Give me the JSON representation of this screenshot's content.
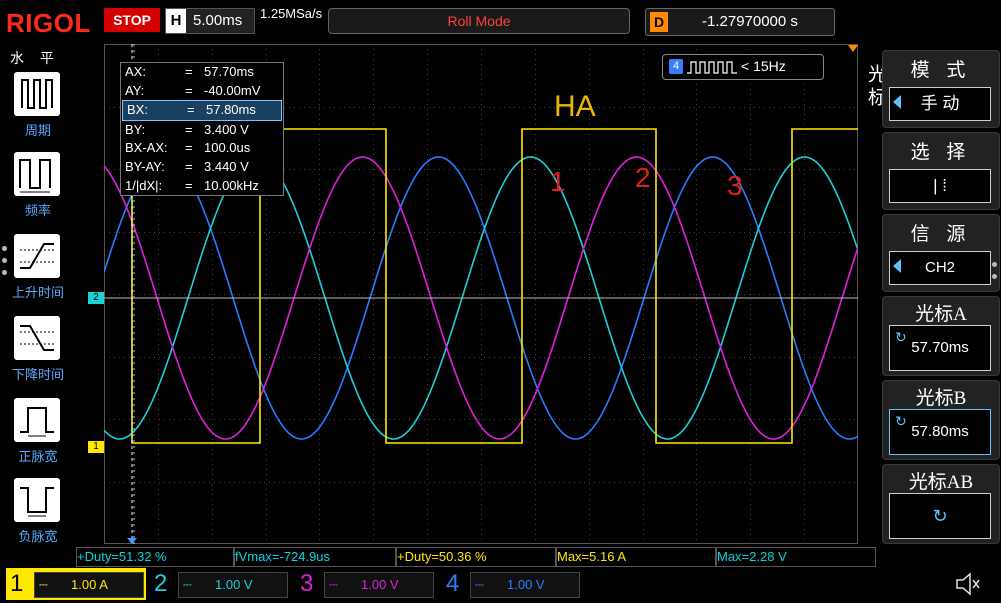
{
  "topbar": {
    "brand": "RIGOL",
    "run_state": "STOP",
    "timebase_tag": "H",
    "timebase": "5.00ms",
    "sample_rate": "1.25MSa/s",
    "mode": "Roll Mode",
    "delay_tag": "D",
    "delay": "-1.27970000 s"
  },
  "left_menu": {
    "header": "水 平",
    "items": [
      {
        "label": "周期",
        "icon": "period-icon"
      },
      {
        "label": "频率",
        "icon": "frequency-icon"
      },
      {
        "label": "上升时间",
        "icon": "rise-time-icon"
      },
      {
        "label": "下降时间",
        "icon": "fall-time-icon"
      },
      {
        "label": "正脉宽",
        "icon": "positive-width-icon"
      },
      {
        "label": "负脉宽",
        "icon": "negative-width-icon"
      }
    ]
  },
  "cursor_table": [
    {
      "key": "AX:",
      "value": "57.70ms"
    },
    {
      "key": "AY:",
      "value": "-40.00mV"
    },
    {
      "key": "BX:",
      "value": "57.80ms"
    },
    {
      "key": "BY:",
      "value": "3.400 V"
    },
    {
      "key": "BX-AX:",
      "value": "100.0us"
    },
    {
      "key": "BY-AY:",
      "value": "3.440 V"
    },
    {
      "key": "1/|dX|:",
      "value": "10.00kHz"
    }
  ],
  "trigger": {
    "channel": "4",
    "frequency": "< 15Hz"
  },
  "annotations": {
    "title": "HA",
    "n1": "1",
    "n2": "2",
    "n3": "3"
  },
  "markers": {
    "ch1": "1",
    "ch2": "2"
  },
  "measurements": [
    {
      "text": "+Duty=51.32 %",
      "color": "#00d8e0"
    },
    {
      "text": "fVmax=-724.9us",
      "color": "#00d8e0"
    },
    {
      "text": "+Duty=50.36 %",
      "color": "#ffe800"
    },
    {
      "text": "Max=5.16 A",
      "color": "#ffe800"
    },
    {
      "text": "Max=2.28 V",
      "color": "#00d8e0"
    }
  ],
  "channels": [
    {
      "num": "1",
      "scale": "1.00 A",
      "color": "#ffe800"
    },
    {
      "num": "2",
      "scale": "1.00 V",
      "color": "#1ed0d8"
    },
    {
      "num": "3",
      "scale": "1.00 V",
      "color": "#e020e0"
    },
    {
      "num": "4",
      "scale": "1.00 V",
      "color": "#2a7cff"
    }
  ],
  "right_menu": {
    "cursor_caption": "光标",
    "mode_title": "模 式",
    "mode_value": "手 动",
    "select_title": "选 择",
    "select_value": "| ⁞",
    "source_title": "信 源",
    "source_value": "CH2",
    "cursor_a_title": "光标A",
    "cursor_a_value": "57.70ms",
    "cursor_b_title": "光标B",
    "cursor_b_value": "57.80ms",
    "cursor_ab_title": "光标AB"
  },
  "colors": {
    "ch1": "#ffe800",
    "ch2": "#1ed0d8",
    "ch3": "#e020e0",
    "ch4": "#2a7cff",
    "brand": "#ff2a1a"
  }
}
